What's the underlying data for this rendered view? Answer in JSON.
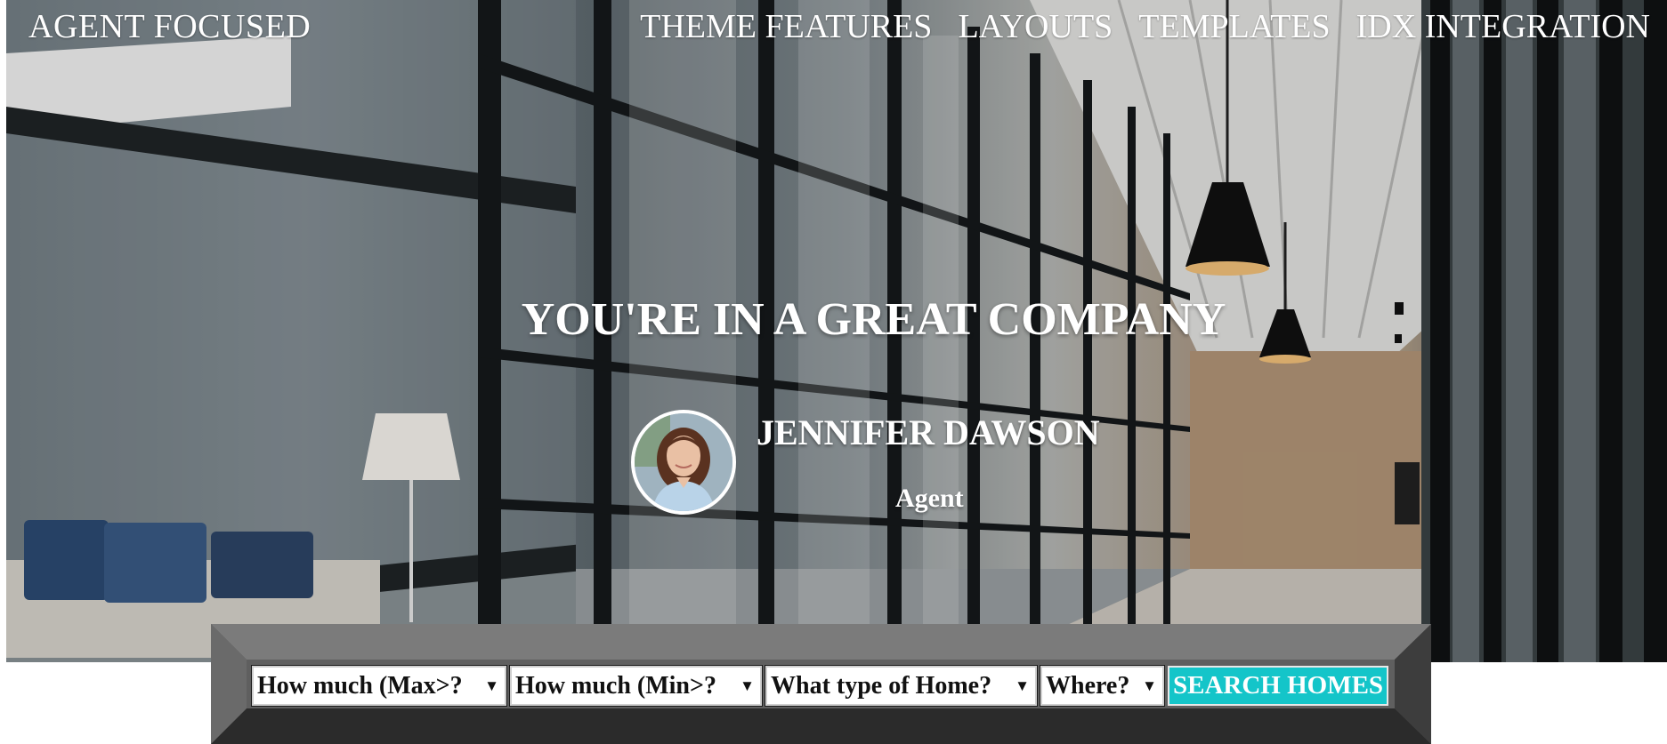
{
  "header": {
    "brand": "AGENT FOCUSED",
    "nav": [
      "THEME FEATURES",
      "LAYOUTS",
      "TEMPLATES",
      "IDX INTEGRATION"
    ]
  },
  "hero": {
    "headline": "YOU'RE IN A GREAT COMPANY",
    "agent_name": "JENNIFER DAWSON",
    "agent_role": "Agent"
  },
  "search": {
    "max_price": "How much (Max>?",
    "min_price": "How much (Min>?",
    "home_type": "What type of Home?",
    "location": "Where?",
    "submit_label": "SEARCH HOMES"
  },
  "colors": {
    "accent": "#14c5c9",
    "panel_light": "#7a7a7a",
    "panel_dark": "#2b2b2b"
  }
}
